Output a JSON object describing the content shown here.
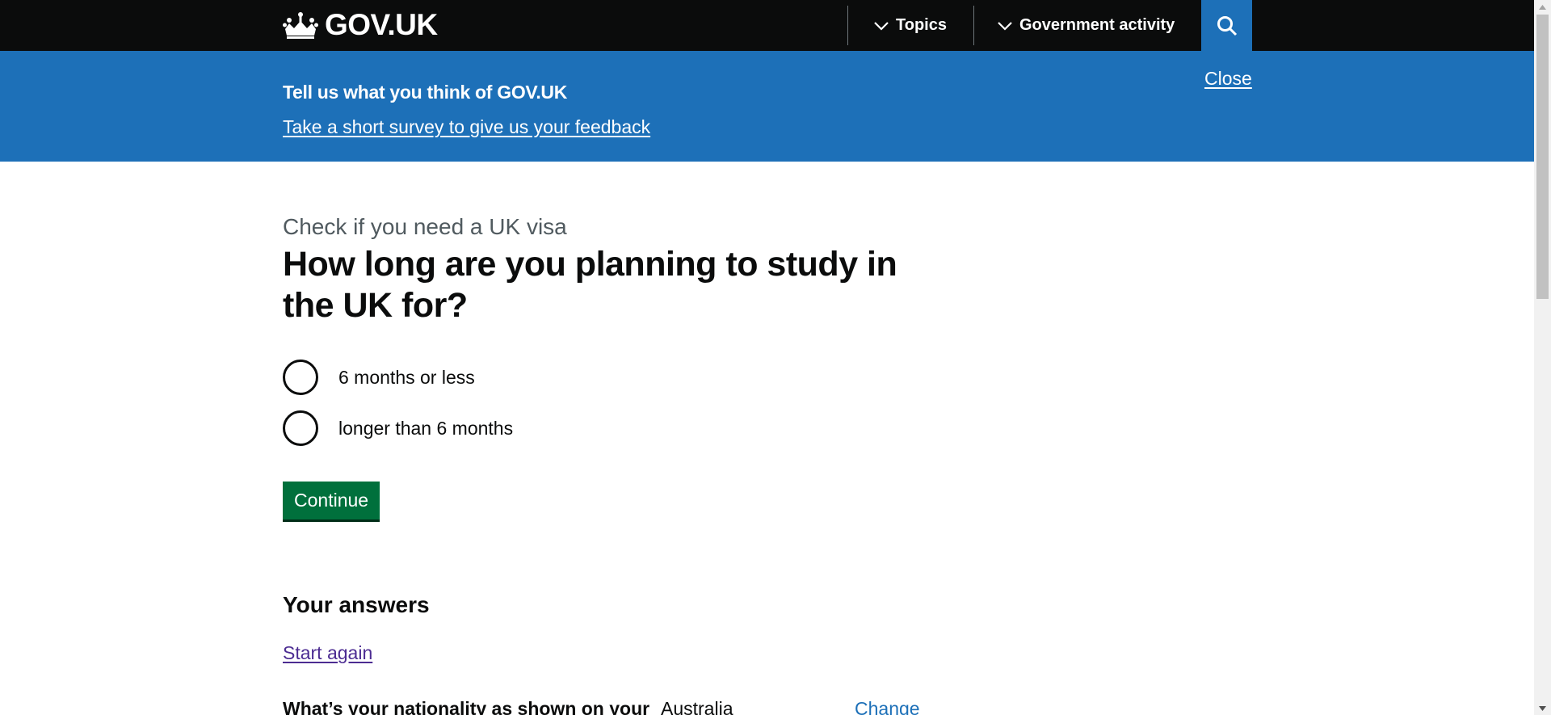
{
  "header": {
    "logo_text": "GOV.UK",
    "nav": [
      {
        "label": "Topics",
        "icon": "chevron-down-icon"
      },
      {
        "label": "Government activity",
        "icon": "chevron-down-icon"
      }
    ],
    "search_icon": "search-icon",
    "background_color": "#0b0c0c"
  },
  "banner": {
    "title": "Tell us what you think of GOV.UK",
    "link": "Take a short survey to give us your feedback",
    "close": "Close",
    "background_color": "#1d70b8"
  },
  "main": {
    "caption": "Check if you need a UK visa",
    "heading": "How long are you planning to study in the UK for?",
    "options": [
      {
        "label": "6 months or less",
        "selected": false
      },
      {
        "label": "longer than 6 months",
        "selected": false
      }
    ],
    "continue_label": "Continue",
    "continue_color": "#00703c"
  },
  "answers": {
    "heading": "Your answers",
    "start_again": "Start again",
    "rows": [
      {
        "question": "What’s your nationality as shown on your",
        "answer": "Australia",
        "change": "Change"
      }
    ]
  }
}
